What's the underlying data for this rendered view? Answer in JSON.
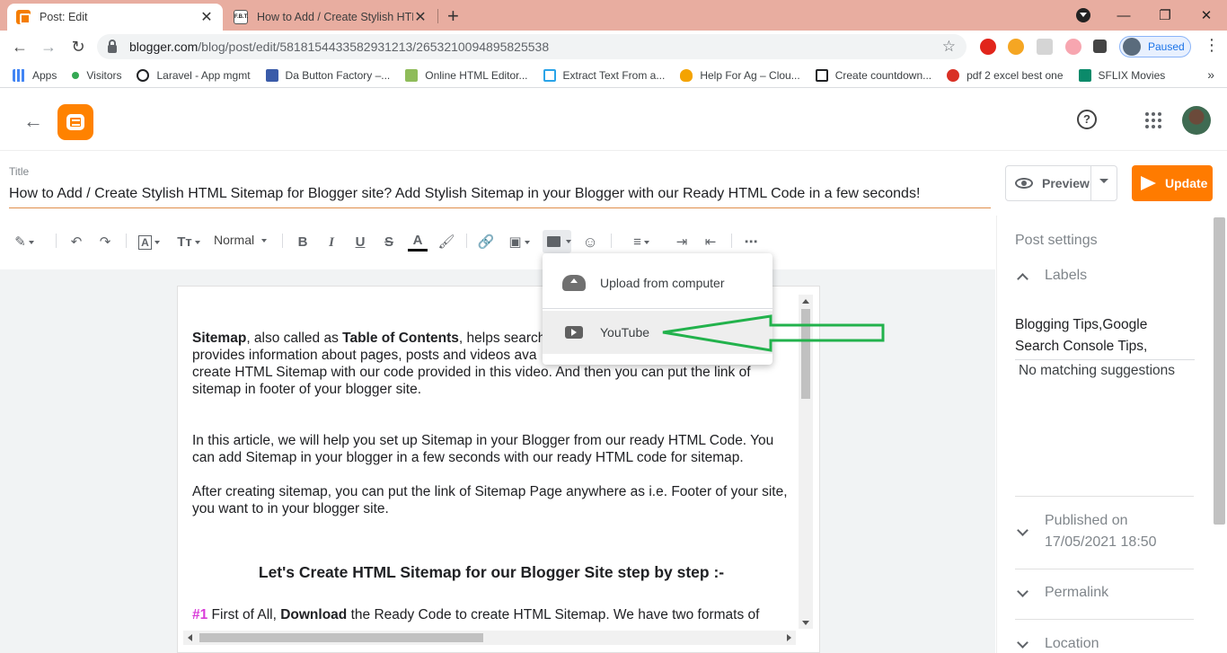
{
  "browser": {
    "tabs": [
      {
        "title": "Post: Edit",
        "active": true
      },
      {
        "title": "How to Add / Create Stylish HTM",
        "active": false
      }
    ],
    "url_host": "blogger.com",
    "url_path": "/blog/post/edit/5818154433582931213/2653210094895825538",
    "profile_status": "Paused",
    "bookmarks": [
      {
        "label": "Apps",
        "icon": "apps-grid-icon",
        "color": "#4285f4"
      },
      {
        "label": "Visitors",
        "icon": "green-dot-icon",
        "color": "#34a853"
      },
      {
        "label": "Laravel - App mgmt",
        "icon": "clock-icon",
        "color": "#202124"
      },
      {
        "label": "Da Button Factory –...",
        "icon": "b-icon",
        "color": "#3a5ba9"
      },
      {
        "label": "Online HTML Editor...",
        "icon": "code-icon",
        "color": "#6b8e23"
      },
      {
        "label": "Extract Text From a...",
        "icon": "b-icon",
        "color": "#2aa4e8"
      },
      {
        "label": "Help For Ag – Clou...",
        "icon": "flame-icon",
        "color": "#f4a300"
      },
      {
        "label": "Create countdown...",
        "icon": "terminal-icon",
        "color": "#202124"
      },
      {
        "label": "pdf 2 excel best one",
        "icon": "heart-icon",
        "color": "#d93025"
      },
      {
        "label": "SFLIX Movies",
        "icon": "s-icon",
        "color": "#0b8a6a"
      }
    ]
  },
  "editor": {
    "title_label": "Title",
    "title_value": "How to Add / Create Stylish HTML Sitemap for Blogger site? Add Stylish Sitemap in your Blogger with our Ready HTML Code in a few seconds!",
    "preview_label": "Preview",
    "update_label": "Update",
    "format_select": "Normal",
    "accent_color": "#ff7b00"
  },
  "video_menu": {
    "upload_label": "Upload from computer",
    "youtube_label": "YouTube"
  },
  "content": {
    "p1_b1": "Sitemap",
    "p1_t1": ", also called as ",
    "p1_b2": "Table of Contents",
    "p1_t2": ", helps search",
    "p1_line2": "provides information about pages, posts and videos ava",
    "p1_line3": "create HTML Sitemap with our code provided in this video. And then you can put the link of",
    "p1_line4": "sitemap in footer of your blogger site.",
    "p2": "In this article, we will help you set up Sitemap in your Blogger from our ready HTML Code. You can add Sitemap in your blogger in a few seconds with our ready HTML code for sitemap.",
    "p3": "After creating sitemap, you can put the link of Sitemap Page anywhere as i.e. Footer of your site, you want to in your blogger site.",
    "heading": "Let's Create HTML Sitemap for our Blogger Site step by step :-",
    "p4_num": "#1",
    "p4_t1": " First of All, ",
    "p4_b": "Download",
    "p4_t2": " the Ready Code to create HTML Sitemap. We have two formats of"
  },
  "side": {
    "title": "Post settings",
    "labels_head": "Labels",
    "labels_value": "Blogging Tips,Google Search Console Tips,",
    "no_match": "No matching suggestions",
    "published_head": "Published on",
    "published_value": "17/05/2021 18:50",
    "permalink_head": "Permalink",
    "location_head": "Location"
  }
}
